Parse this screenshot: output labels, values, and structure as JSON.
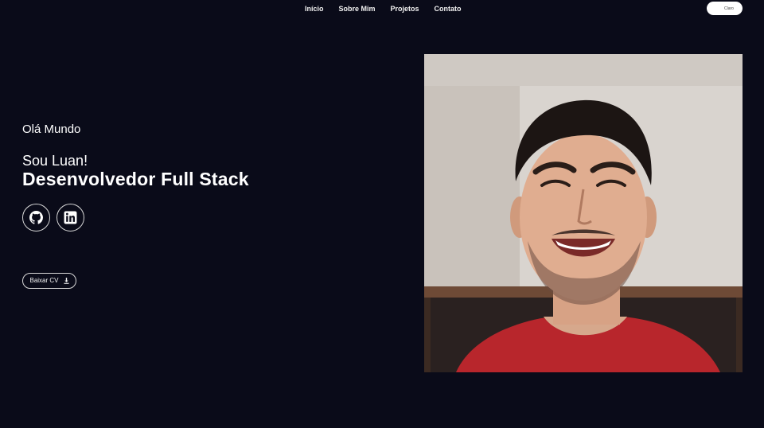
{
  "nav": {
    "links": [
      "Início",
      "Sobre Mim",
      "Projetos",
      "Contato"
    ],
    "theme_toggle_label": "Claro",
    "theme_icon": "moon-icon"
  },
  "hero": {
    "greeting": "Olá Mundo",
    "intro": "Sou Luan!",
    "role": "Desenvolvedor Full Stack",
    "socials": [
      {
        "name": "GitHub",
        "icon": "github-icon"
      },
      {
        "name": "LinkedIn",
        "icon": "linkedin-icon"
      }
    ],
    "cv_button": "Baixar CV",
    "cv_icon": "download-icon"
  },
  "photo": {
    "alt": "Profile photo"
  },
  "colors": {
    "background": "#0a0b19",
    "text": "#ffffff",
    "shirt": "#b8262c"
  }
}
